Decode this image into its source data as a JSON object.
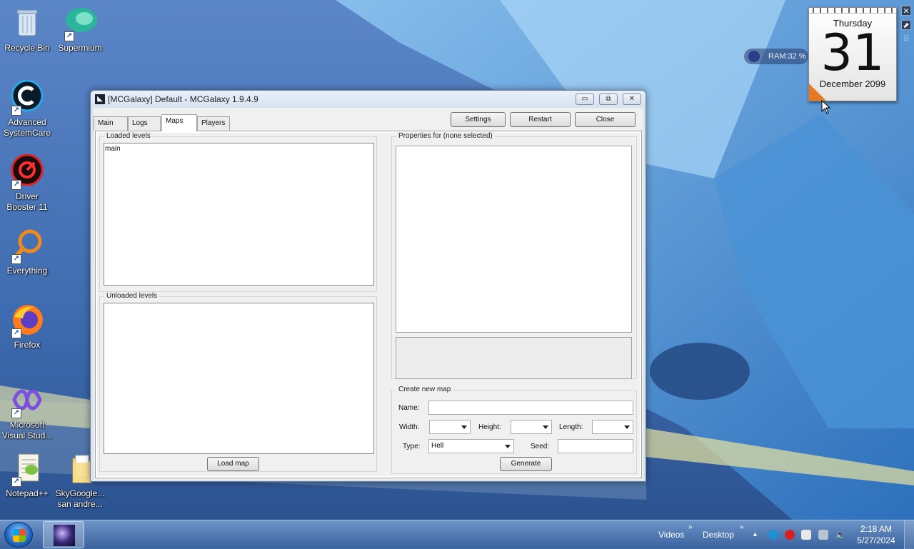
{
  "desktop": {
    "icons": [
      {
        "label": "Recycle Bin",
        "icon": "recycle-bin-icon"
      },
      {
        "label": "Supermium",
        "icon": "supermium-icon"
      },
      {
        "label": "Advanced SystemCare",
        "icon": "advanced-systemcare-icon"
      },
      {
        "label": "Driver Booster 11",
        "icon": "driver-booster-icon"
      },
      {
        "label": "Everything",
        "icon": "everything-search-icon"
      },
      {
        "label": "Firefox",
        "icon": "firefox-icon"
      },
      {
        "label": "Microsoft Visual Stud...",
        "icon": "visual-studio-icon"
      },
      {
        "label": "Notepad++",
        "icon": "notepadpp-icon"
      },
      {
        "label": "SkyGoogle... san andre...",
        "icon": "folder-icon"
      }
    ]
  },
  "gadgets": {
    "calendar": {
      "weekday": "Thursday",
      "day": "31",
      "month_year": "December 2099"
    },
    "ram": {
      "label": "RAM:32 %"
    }
  },
  "window": {
    "title": "[MCGalaxy] Default - MCGalaxy 1.9.4.9",
    "caption_buttons": {
      "minimize": "▭",
      "maximize": "⧉",
      "close": "✕"
    },
    "tabs": [
      {
        "label": "Main"
      },
      {
        "label": "Logs"
      },
      {
        "label": "Maps"
      },
      {
        "label": "Players"
      }
    ],
    "toolbar": {
      "settings": "Settings",
      "restart": "Restart",
      "close": "Close"
    },
    "maps": {
      "loaded_title": "Loaded levels",
      "loaded_items": [
        "main"
      ],
      "unloaded_title": "Unloaded levels",
      "unloaded_items": [],
      "load_button": "Load map",
      "properties_title": "Properties for (none selected)",
      "create": {
        "title": "Create new map",
        "name_label": "Name:",
        "name_value": "",
        "width_label": "Width:",
        "width_value": "",
        "height_label": "Height:",
        "height_value": "",
        "length_label": "Length:",
        "length_value": "",
        "type_label": "Type:",
        "type_value": "Hell",
        "seed_label": "Seed:",
        "seed_value": "",
        "generate_button": "Generate"
      }
    }
  },
  "taskbar": {
    "toolbar_videos": "Videos",
    "toolbar_desktop": "Desktop",
    "chevron": "»",
    "tray_expand": "▲",
    "time": "2:18 AM",
    "date": "5/27/2024"
  },
  "colors": {
    "window_frame": "#d9e4f1",
    "taskbar": "#4a7fc0",
    "calendar_fold": "#e67a22"
  }
}
